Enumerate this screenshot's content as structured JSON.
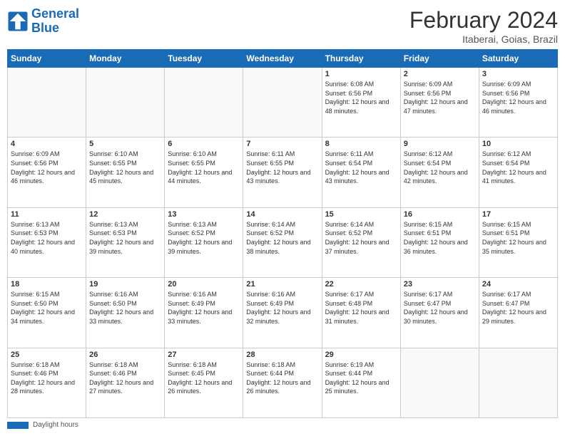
{
  "logo": {
    "line1": "General",
    "line2": "Blue"
  },
  "title": "February 2024",
  "subtitle": "Itaberai, Goias, Brazil",
  "days_of_week": [
    "Sunday",
    "Monday",
    "Tuesday",
    "Wednesday",
    "Thursday",
    "Friday",
    "Saturday"
  ],
  "footer_label": "Daylight hours",
  "weeks": [
    [
      {
        "day": "",
        "info": ""
      },
      {
        "day": "",
        "info": ""
      },
      {
        "day": "",
        "info": ""
      },
      {
        "day": "",
        "info": ""
      },
      {
        "day": "1",
        "info": "Sunrise: 6:08 AM\nSunset: 6:56 PM\nDaylight: 12 hours and 48 minutes."
      },
      {
        "day": "2",
        "info": "Sunrise: 6:09 AM\nSunset: 6:56 PM\nDaylight: 12 hours and 47 minutes."
      },
      {
        "day": "3",
        "info": "Sunrise: 6:09 AM\nSunset: 6:56 PM\nDaylight: 12 hours and 46 minutes."
      }
    ],
    [
      {
        "day": "4",
        "info": "Sunrise: 6:09 AM\nSunset: 6:56 PM\nDaylight: 12 hours and 46 minutes."
      },
      {
        "day": "5",
        "info": "Sunrise: 6:10 AM\nSunset: 6:55 PM\nDaylight: 12 hours and 45 minutes."
      },
      {
        "day": "6",
        "info": "Sunrise: 6:10 AM\nSunset: 6:55 PM\nDaylight: 12 hours and 44 minutes."
      },
      {
        "day": "7",
        "info": "Sunrise: 6:11 AM\nSunset: 6:55 PM\nDaylight: 12 hours and 43 minutes."
      },
      {
        "day": "8",
        "info": "Sunrise: 6:11 AM\nSunset: 6:54 PM\nDaylight: 12 hours and 43 minutes."
      },
      {
        "day": "9",
        "info": "Sunrise: 6:12 AM\nSunset: 6:54 PM\nDaylight: 12 hours and 42 minutes."
      },
      {
        "day": "10",
        "info": "Sunrise: 6:12 AM\nSunset: 6:54 PM\nDaylight: 12 hours and 41 minutes."
      }
    ],
    [
      {
        "day": "11",
        "info": "Sunrise: 6:13 AM\nSunset: 6:53 PM\nDaylight: 12 hours and 40 minutes."
      },
      {
        "day": "12",
        "info": "Sunrise: 6:13 AM\nSunset: 6:53 PM\nDaylight: 12 hours and 39 minutes."
      },
      {
        "day": "13",
        "info": "Sunrise: 6:13 AM\nSunset: 6:52 PM\nDaylight: 12 hours and 39 minutes."
      },
      {
        "day": "14",
        "info": "Sunrise: 6:14 AM\nSunset: 6:52 PM\nDaylight: 12 hours and 38 minutes."
      },
      {
        "day": "15",
        "info": "Sunrise: 6:14 AM\nSunset: 6:52 PM\nDaylight: 12 hours and 37 minutes."
      },
      {
        "day": "16",
        "info": "Sunrise: 6:15 AM\nSunset: 6:51 PM\nDaylight: 12 hours and 36 minutes."
      },
      {
        "day": "17",
        "info": "Sunrise: 6:15 AM\nSunset: 6:51 PM\nDaylight: 12 hours and 35 minutes."
      }
    ],
    [
      {
        "day": "18",
        "info": "Sunrise: 6:15 AM\nSunset: 6:50 PM\nDaylight: 12 hours and 34 minutes."
      },
      {
        "day": "19",
        "info": "Sunrise: 6:16 AM\nSunset: 6:50 PM\nDaylight: 12 hours and 33 minutes."
      },
      {
        "day": "20",
        "info": "Sunrise: 6:16 AM\nSunset: 6:49 PM\nDaylight: 12 hours and 33 minutes."
      },
      {
        "day": "21",
        "info": "Sunrise: 6:16 AM\nSunset: 6:49 PM\nDaylight: 12 hours and 32 minutes."
      },
      {
        "day": "22",
        "info": "Sunrise: 6:17 AM\nSunset: 6:48 PM\nDaylight: 12 hours and 31 minutes."
      },
      {
        "day": "23",
        "info": "Sunrise: 6:17 AM\nSunset: 6:47 PM\nDaylight: 12 hours and 30 minutes."
      },
      {
        "day": "24",
        "info": "Sunrise: 6:17 AM\nSunset: 6:47 PM\nDaylight: 12 hours and 29 minutes."
      }
    ],
    [
      {
        "day": "25",
        "info": "Sunrise: 6:18 AM\nSunset: 6:46 PM\nDaylight: 12 hours and 28 minutes."
      },
      {
        "day": "26",
        "info": "Sunrise: 6:18 AM\nSunset: 6:46 PM\nDaylight: 12 hours and 27 minutes."
      },
      {
        "day": "27",
        "info": "Sunrise: 6:18 AM\nSunset: 6:45 PM\nDaylight: 12 hours and 26 minutes."
      },
      {
        "day": "28",
        "info": "Sunrise: 6:18 AM\nSunset: 6:44 PM\nDaylight: 12 hours and 26 minutes."
      },
      {
        "day": "29",
        "info": "Sunrise: 6:19 AM\nSunset: 6:44 PM\nDaylight: 12 hours and 25 minutes."
      },
      {
        "day": "",
        "info": ""
      },
      {
        "day": "",
        "info": ""
      }
    ]
  ]
}
